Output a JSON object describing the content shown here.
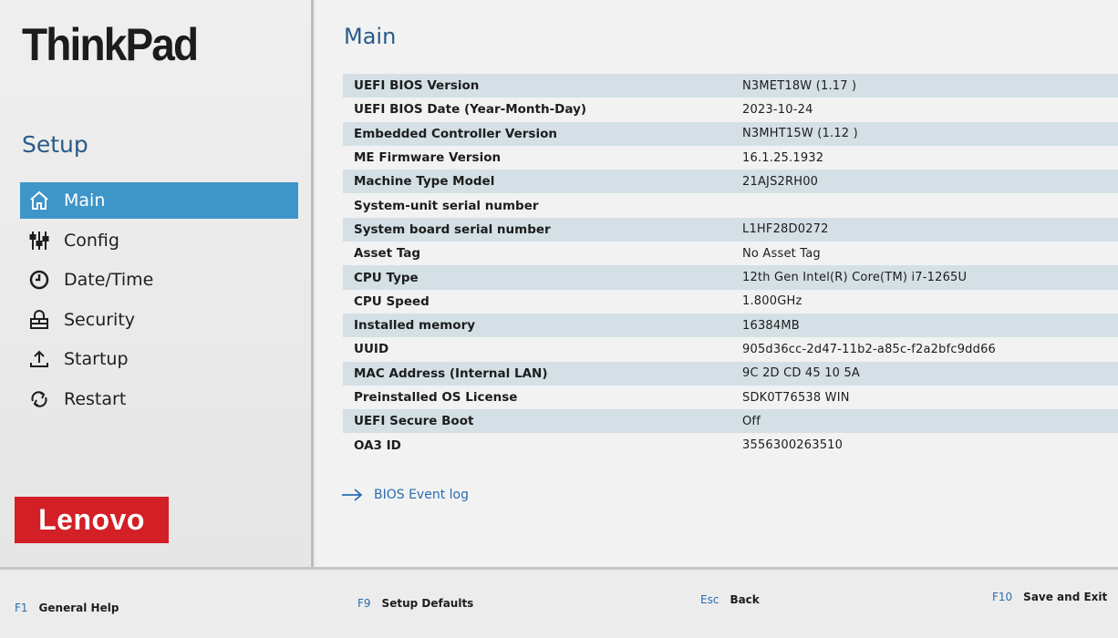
{
  "sidebar": {
    "brand": "ThinkPad",
    "title": "Setup",
    "items": [
      {
        "label": "Main",
        "icon": "home-icon",
        "active": true
      },
      {
        "label": "Config",
        "icon": "sliders-icon",
        "active": false
      },
      {
        "label": "Date/Time",
        "icon": "clock-icon",
        "active": false
      },
      {
        "label": "Security",
        "icon": "lock-icon",
        "active": false
      },
      {
        "label": "Startup",
        "icon": "upload-icon",
        "active": false
      },
      {
        "label": "Restart",
        "icon": "restart-icon",
        "active": false
      }
    ],
    "logo": "Lenovo"
  },
  "main": {
    "title": "Main",
    "rows": [
      {
        "label": "UEFI BIOS Version",
        "value": "N3MET18W (1.17 )"
      },
      {
        "label": "UEFI BIOS Date (Year-Month-Day)",
        "value": "2023-10-24"
      },
      {
        "label": "Embedded Controller Version",
        "value": "N3MHT15W (1.12 )"
      },
      {
        "label": "ME Firmware Version",
        "value": "16.1.25.1932"
      },
      {
        "label": "Machine Type Model",
        "value": "21AJS2RH00"
      },
      {
        "label": "System-unit serial number",
        "value": ""
      },
      {
        "label": "System board serial number",
        "value": "L1HF28D0272"
      },
      {
        "label": "Asset Tag",
        "value": "No Asset Tag"
      },
      {
        "label": "CPU Type",
        "value": "12th Gen Intel(R) Core(TM) i7-1265U"
      },
      {
        "label": "CPU Speed",
        "value": "1.800GHz"
      },
      {
        "label": "Installed memory",
        "value": "16384MB"
      },
      {
        "label": "UUID",
        "value": "905d36cc-2d47-11b2-a85c-f2a2bfc9dd66"
      },
      {
        "label": "MAC Address (Internal LAN)",
        "value": "9C 2D CD 45 10 5A"
      },
      {
        "label": "Preinstalled OS License",
        "value": "SDK0T76538 WIN"
      },
      {
        "label": "UEFI Secure Boot",
        "value": "Off"
      },
      {
        "label": "OA3 ID",
        "value": "3556300263510"
      }
    ],
    "event_log": "BIOS Event log"
  },
  "footer": {
    "help": {
      "key": "F1",
      "label": "General Help"
    },
    "defaults": {
      "key": "F9",
      "label": "Setup Defaults"
    },
    "back": {
      "key": "Esc",
      "label": "Back"
    },
    "save": {
      "key": "F10",
      "label": "Save and Exit"
    }
  },
  "colors": {
    "accent": "#3e95c8",
    "title_blue": "#2a5a88",
    "row_shade": "#d4e0e5",
    "lenovo_red": "#d31f26"
  }
}
